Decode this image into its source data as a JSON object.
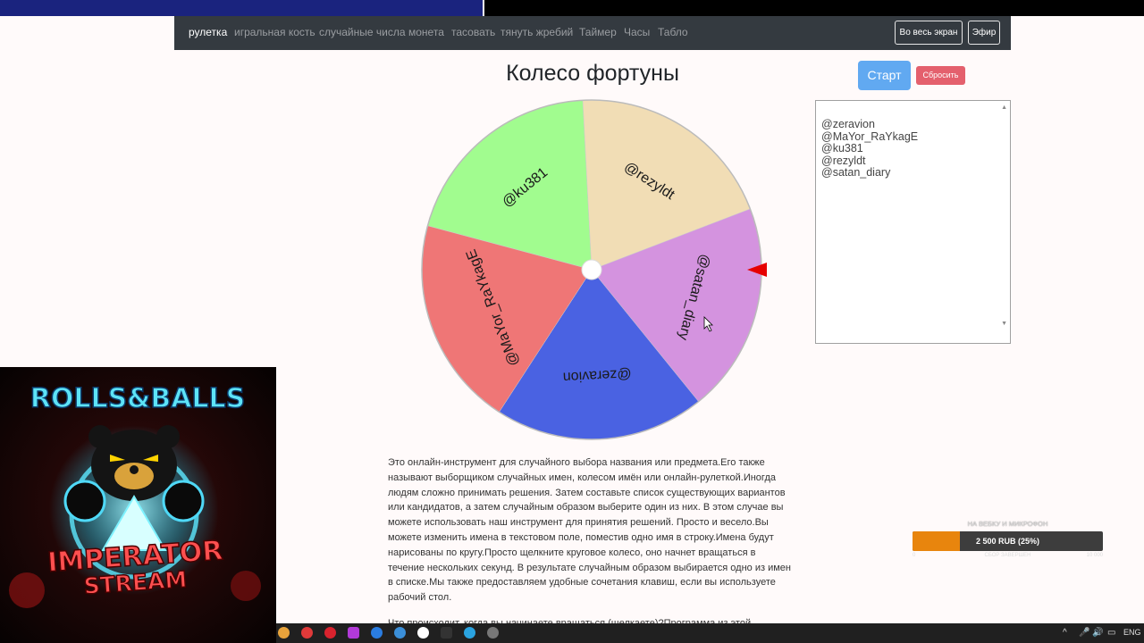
{
  "nav": {
    "items": [
      "рулетка",
      "игральная кость",
      "случайные числа",
      "монета",
      "тасовать",
      "тянуть жребий",
      "Таймер",
      "Часы",
      "Табло"
    ],
    "active_index": 0,
    "fullscreen_label": "Во весь экран",
    "broadcast_label": "Эфир"
  },
  "page": {
    "title": "Колесо фортуны",
    "start_label": "Старт",
    "reset_label": "Сбросить"
  },
  "names": [
    "@zeravion",
    "@MaYor_RaYkagE",
    "@ku381",
    "@rezyldt",
    "@satan_diary"
  ],
  "wheel": {
    "segments": [
      {
        "name": "@ku381",
        "color": "#a1fc8f"
      },
      {
        "name": "@rezyldt",
        "color": "#f1ddb5"
      },
      {
        "name": "@satan_diary",
        "color": "#d493df"
      },
      {
        "name": "@zeravion",
        "color": "#4a62e2"
      },
      {
        "name": "@MaYor_RaYkagE",
        "color": "#ef7676"
      }
    ],
    "pointer_color": "#e60000"
  },
  "description": {
    "paragraph": "Это онлайн-инструмент для случайного выбора названия или предмета.Его также называют выборщиком случайных имен, колесом имён или онлайн-рулеткой.Иногда людям сложно принимать решения. Затем составьте список существующих вариантов или кандидатов, а затем случайным образом выберите один из них. В этом случае вы можете использовать наш инструмент для принятия решений. Просто и весело.Вы можете изменить имена в текстовом поле, поместив одно имя в строку.Имена будут нарисованы по кругу.Просто щелкните круговое колесо, оно начнет вращаться в течение нескольких секунд. В результате случайным образом выбирается одно из имен в списке.Мы также предоставляем удобные сочетания клавиш, если вы используете рабочий стол.",
    "cut_line": "Что происходит, когда вы начинаете вращаться (щелкаете)?Программа из этой"
  },
  "stream": {
    "logo_line1": "ROLLS&BALLS",
    "logo_line2": "IMPERATOR",
    "logo_line3": "STREAM"
  },
  "donation": {
    "label": "НА ВЕБКУ И МИКРОФОН",
    "amount_text": "2 500 RUB (25%)",
    "progress": 0.25,
    "min": "0",
    "sub": "СБОР ЗАВЕРШЕН",
    "max": "10 000"
  },
  "taskbar": {
    "lang": "ENG"
  }
}
